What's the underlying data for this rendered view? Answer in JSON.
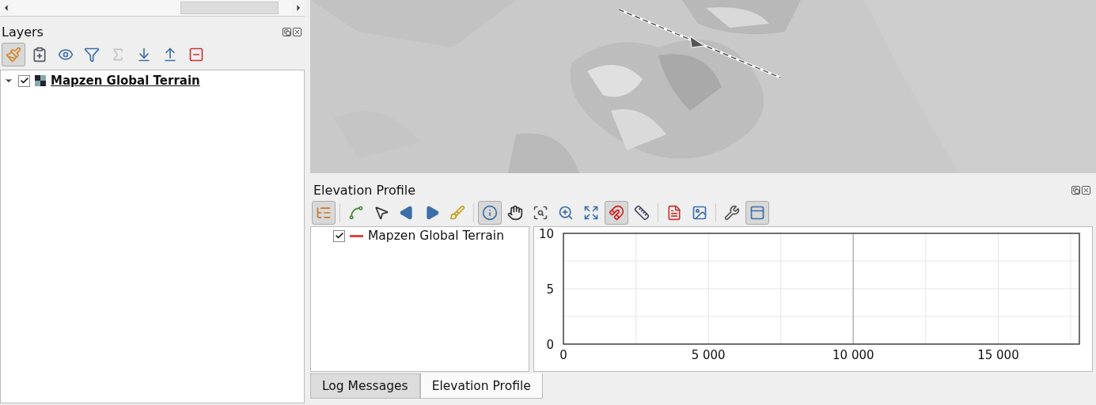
{
  "layers_panel": {
    "title": "Layers",
    "toolbar": [
      {
        "selected": true,
        "disabled": false
      },
      {
        "selected": false,
        "disabled": false
      },
      {
        "selected": false,
        "disabled": false
      },
      {
        "selected": false,
        "disabled": false
      },
      {
        "selected": false,
        "disabled": true
      },
      {
        "selected": false,
        "disabled": false
      },
      {
        "selected": false,
        "disabled": false
      },
      {
        "selected": false,
        "disabled": false
      }
    ],
    "tree": [
      {
        "name": "Mapzen Global Terrain",
        "checked": true,
        "expanded": true
      }
    ]
  },
  "elevation_profile": {
    "title": "Elevation Profile",
    "toolbar": [
      {
        "kind": "button",
        "selected": true
      },
      {
        "kind": "separator"
      },
      {
        "kind": "button",
        "selected": false
      },
      {
        "kind": "button",
        "selected": false
      },
      {
        "kind": "button",
        "selected": false
      },
      {
        "kind": "button",
        "selected": false
      },
      {
        "kind": "button",
        "selected": false
      },
      {
        "kind": "separator"
      },
      {
        "kind": "button",
        "selected": true
      },
      {
        "kind": "button",
        "selected": false
      },
      {
        "kind": "button",
        "selected": false
      },
      {
        "kind": "button",
        "selected": false
      },
      {
        "kind": "button",
        "selected": false
      },
      {
        "kind": "button",
        "selected": true
      },
      {
        "kind": "button",
        "selected": false
      },
      {
        "kind": "separator"
      },
      {
        "kind": "button",
        "selected": false
      },
      {
        "kind": "button",
        "selected": false
      },
      {
        "kind": "separator"
      },
      {
        "kind": "button",
        "selected": false
      },
      {
        "kind": "button",
        "selected": true
      }
    ],
    "layers": [
      {
        "name": "Mapzen Global Terrain",
        "checked": true,
        "color": "#d9453f"
      }
    ],
    "chart_data": {
      "type": "line",
      "xlim": [
        0,
        17800
      ],
      "ylim": [
        0,
        10
      ],
      "grid": true,
      "ref_lines": [
        {
          "axis": "x",
          "value": 10000
        }
      ],
      "xticks": [
        {
          "value": 0,
          "label": "0"
        },
        {
          "value": 5000,
          "label": "5 000"
        },
        {
          "value": 10000,
          "label": "10 000"
        },
        {
          "value": 15000,
          "label": "15 000"
        }
      ],
      "yticks": [
        {
          "value": 0,
          "label": "0"
        },
        {
          "value": 5,
          "label": "5"
        },
        {
          "value": 10,
          "label": "10"
        }
      ]
    }
  },
  "bottom_tabs": [
    {
      "label": "Log Messages",
      "selected": false
    },
    {
      "label": "Elevation Profile",
      "selected": true
    }
  ]
}
